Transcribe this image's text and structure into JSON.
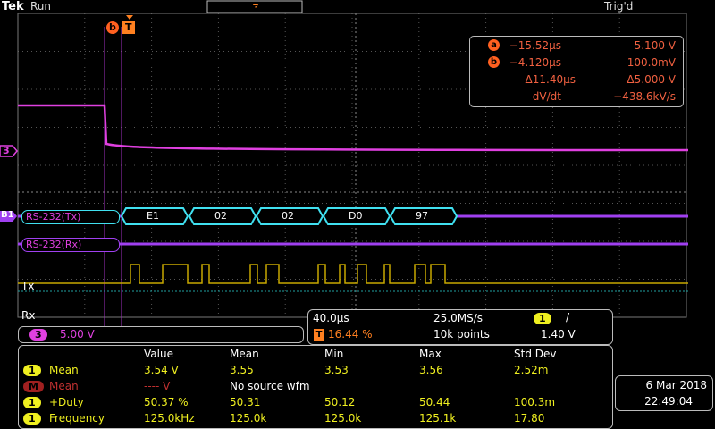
{
  "header": {
    "brand": "Tek",
    "run_state": "Run",
    "trigger_state": "Trig'd",
    "trigger_marker": "T"
  },
  "markers": {
    "b_label": "b",
    "t_label": "T",
    "ch3_label": "3",
    "b1_label": "B1"
  },
  "cursor_readout": {
    "a_label": "a",
    "a_time": "−15.52μs",
    "a_volt": "5.100 V",
    "b_label": "b",
    "b_time": "−4.120μs",
    "b_volt": "100.0mV",
    "delta_time": "Δ11.40μs",
    "delta_volt": "Δ5.000 V",
    "dvdt_label": "dV/dt",
    "dvdt_value": "−438.6kV/s"
  },
  "bus": {
    "tx_label": "RS-232(Tx)",
    "rx_label": "RS-232(Rx)",
    "packets": [
      "E1",
      "02",
      "02",
      "D0",
      "97"
    ]
  },
  "digital": {
    "tx_label": "Tx",
    "rx_label": "Rx"
  },
  "channel_scale": {
    "ch": "3",
    "value": "5.00 V"
  },
  "acquisition": {
    "timebase": "40.0μs",
    "sample_rate": "25.0MS/s",
    "trig_ch": "1",
    "trig_slope": "/",
    "trig_pos_label": "T",
    "trig_pos": "16.44 %",
    "record_length": "10k points",
    "trig_level": "1.40 V"
  },
  "measurements": {
    "headers": [
      "Value",
      "Mean",
      "Min",
      "Max",
      "Std Dev"
    ],
    "rows": [
      {
        "ch": "1",
        "name": "Mean",
        "value": "3.54 V",
        "mean": "3.55",
        "min": "3.53",
        "max": "3.56",
        "std": "2.52m"
      },
      {
        "ch": "M",
        "name": "Mean",
        "value": "---- V",
        "note": "No source wfm"
      },
      {
        "ch": "1",
        "name": "+Duty",
        "value": "50.37 %",
        "mean": "50.31",
        "min": "50.12",
        "max": "50.44",
        "std": "100.3m"
      },
      {
        "ch": "1",
        "name": "Frequency",
        "value": "125.0kHz",
        "mean": "125.0k",
        "min": "125.0k",
        "max": "125.1k",
        "std": "17.80"
      }
    ]
  },
  "datetime": {
    "date": "6 Mar  2018",
    "time": "22:49:04"
  },
  "colors": {
    "ch1": "#f0f020",
    "ch3": "#e040e0",
    "bus": "#40e0f0",
    "cursor": "#a030c0",
    "accent": "#ff6020"
  }
}
